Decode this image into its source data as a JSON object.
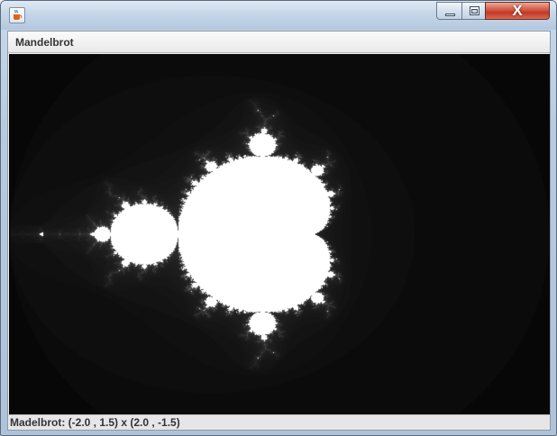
{
  "window": {
    "title": "",
    "controls": {
      "minimize": "",
      "maximize": "",
      "close": "X"
    }
  },
  "panel": {
    "title": "Mandelbrot"
  },
  "status": {
    "text": "Madelbrot: (-2.0 , 1.5) x (2.0 , -1.5)"
  },
  "fractal": {
    "region": {
      "re_min": -2.0,
      "re_max": 2.0,
      "im_min": -1.5,
      "im_max": 1.5
    },
    "set_color": "#ffffff",
    "background_color": "#000000"
  },
  "icons": {
    "app": "java-cup-icon"
  }
}
